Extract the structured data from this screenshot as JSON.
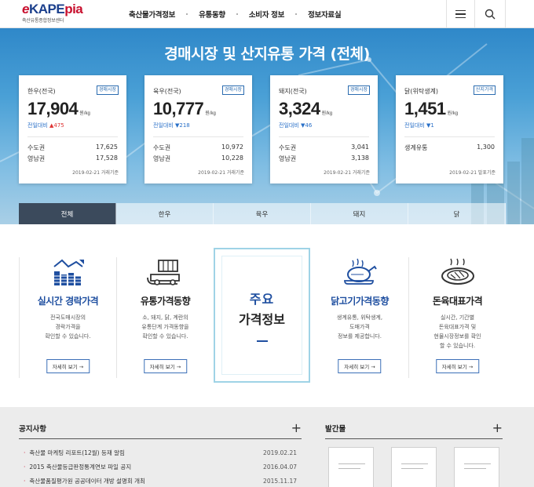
{
  "header": {
    "logo_e": "e",
    "logo_k": "KAPE",
    "logo_p": "pia",
    "logo_sub": "축산유통종합정보센터",
    "nav": [
      "축산물가격정보",
      "유통동향",
      "소비자 정보",
      "정보자료실"
    ]
  },
  "hero": {
    "title": "경매시장 및 산지유통 가격 (전체)",
    "cards": [
      {
        "name": "한우(전국)",
        "badge": "경매시장",
        "price": "17,904",
        "unit": "원/kg",
        "change_label": "전일대비",
        "change_dir": "up",
        "change_arrow": "▲",
        "change": "475",
        "rows": [
          {
            "label": "수도권",
            "value": "17,625"
          },
          {
            "label": "영남권",
            "value": "17,528"
          }
        ],
        "date": "2019-02-21 거래기준"
      },
      {
        "name": "육우(전국)",
        "badge": "경매시장",
        "price": "10,777",
        "unit": "원/kg",
        "change_label": "전일대비",
        "change_dir": "down",
        "change_arrow": "▼",
        "change": "218",
        "rows": [
          {
            "label": "수도권",
            "value": "10,972"
          },
          {
            "label": "영남권",
            "value": "10,228"
          }
        ],
        "date": "2019-02-21 거래기준"
      },
      {
        "name": "돼지(전국)",
        "badge": "경매시장",
        "price": "3,324",
        "unit": "원/kg",
        "change_label": "전일대비",
        "change_dir": "down",
        "change_arrow": "▼",
        "change": "46",
        "rows": [
          {
            "label": "수도권",
            "value": "3,041"
          },
          {
            "label": "영남권",
            "value": "3,138"
          }
        ],
        "date": "2019-02-21 거래기준"
      },
      {
        "name": "닭(위탁생계)",
        "badge": "산지가격",
        "price": "1,451",
        "unit": "원/kg",
        "change_label": "전일대비",
        "change_dir": "down",
        "change_arrow": "▼",
        "change": "1",
        "rows": [
          {
            "label": "생계유통",
            "value": "1,300"
          }
        ],
        "date": "2019-02-21 발표기준"
      }
    ],
    "tabs": [
      "전체",
      "한우",
      "육우",
      "돼지",
      "닭"
    ],
    "active_tab": 0
  },
  "services": {
    "items": [
      {
        "title": "실시간 경락가격",
        "desc": "전국도매시장의\n경락가격을\n확인할 수 있습니다.",
        "button": "자세히 보기 →",
        "icon": "bar-chart-icon"
      },
      {
        "title": "유통가격동향",
        "desc": "소, 돼지, 닭, 계란의\n유통단계 가격동향을\n확인할 수 있습니다.",
        "button": "자세히 보기 →",
        "icon": "delivery-truck-icon"
      },
      {
        "title": "닭고기가격동향",
        "desc": "생계유통, 위탁생계,\n도매가격\n정보를 제공합니다.",
        "button": "자세히 보기 →",
        "icon": "roast-chicken-icon"
      },
      {
        "title": "돈육대표가격",
        "desc": "실시간, 기간별\n돈육대표가격 및\n현물시장정보를 확인\n할 수 있습니다.",
        "button": "자세히 보기 →",
        "icon": "steak-plate-icon"
      }
    ],
    "center_line1": "주요",
    "center_line2": "가격정보"
  },
  "notice": {
    "title": "공지사항",
    "more": "+",
    "items": [
      {
        "title": "축산물 마케팅 리포트(12월) 등재 알림",
        "date": "2019.02.21"
      },
      {
        "title": "2015 축산물등급판정통계연보 파일 공지",
        "date": "2016.04.07"
      },
      {
        "title": "축산물품질평가원 공공데이터 개방 설명회 개최",
        "date": "2015.11.17"
      }
    ]
  },
  "publications": {
    "title": "발간물",
    "more": "+"
  },
  "colors": {
    "brand_blue": "#1f4fa0",
    "brand_red": "#c8102e",
    "tab_active": "#3b4a5c",
    "up": "#dd3333",
    "down": "#2a70c8"
  }
}
